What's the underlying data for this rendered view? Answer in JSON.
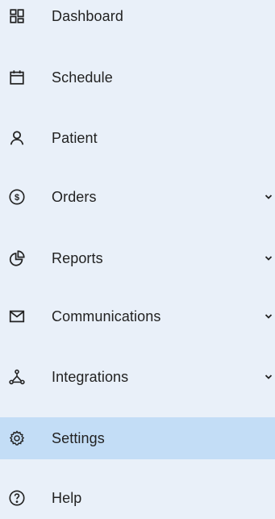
{
  "sidebar": {
    "items": [
      {
        "label": "Dashboard",
        "icon": "dashboard-grid-icon",
        "expandable": false,
        "active": false
      },
      {
        "label": "Schedule",
        "icon": "calendar-icon",
        "expandable": false,
        "active": false
      },
      {
        "label": "Patient",
        "icon": "person-icon",
        "expandable": false,
        "active": false
      },
      {
        "label": "Orders",
        "icon": "dollar-circle-icon",
        "expandable": true,
        "active": false
      },
      {
        "label": "Reports",
        "icon": "pie-chart-icon",
        "expandable": true,
        "active": false
      },
      {
        "label": "Communications",
        "icon": "mail-icon",
        "expandable": true,
        "active": false
      },
      {
        "label": "Integrations",
        "icon": "hub-icon",
        "expandable": true,
        "active": false
      },
      {
        "label": "Settings",
        "icon": "gear-icon",
        "expandable": false,
        "active": true
      },
      {
        "label": "Help",
        "icon": "help-circle-icon",
        "expandable": false,
        "active": false
      }
    ]
  },
  "colors": {
    "background": "#e9f0f9",
    "active_background": "#c3ddf6",
    "text": "#222222",
    "icon": "#222222"
  }
}
